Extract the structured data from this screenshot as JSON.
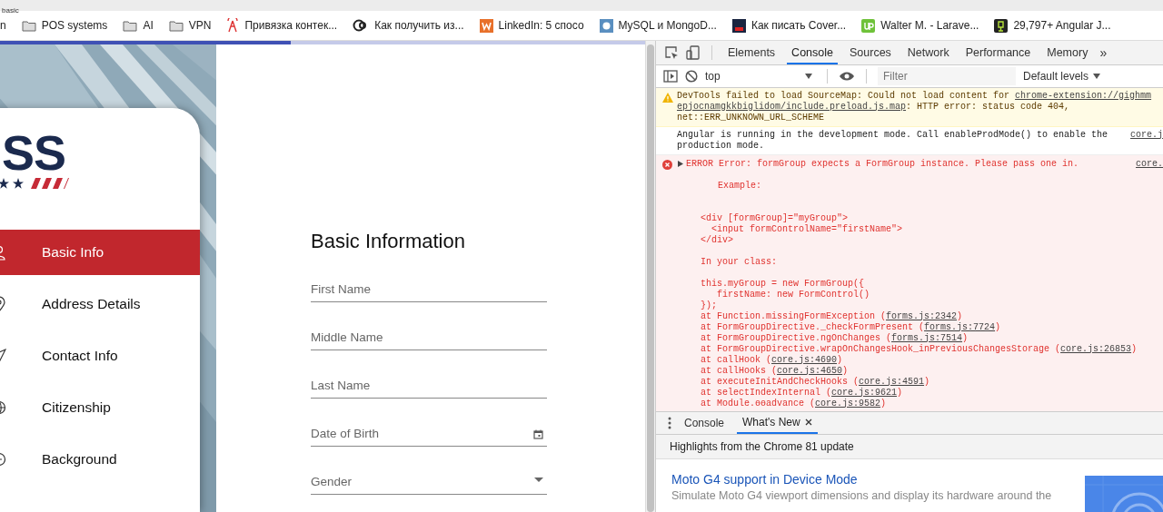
{
  "browser": {
    "tab_title": "basic",
    "bookmarks": [
      {
        "label": "n",
        "kind": "plain"
      },
      {
        "label": "POS systems",
        "kind": "folder"
      },
      {
        "label": "AI",
        "kind": "folder"
      },
      {
        "label": "VPN",
        "kind": "folder"
      },
      {
        "label": "Привязка контек...",
        "kind": "tower"
      },
      {
        "label": "Как получить из...",
        "kind": "ring"
      },
      {
        "label": "LinkedIn: 5 спосо",
        "kind": "w"
      },
      {
        "label": "MySQL и MongoD...",
        "kind": "puzzle"
      },
      {
        "label": "Как писать Cover...",
        "kind": "jff"
      },
      {
        "label": "Walter M. - Larave...",
        "kind": "up"
      },
      {
        "label": "29,797+ Angular J...",
        "kind": "chair"
      }
    ]
  },
  "page": {
    "progress": {
      "level": 0.45
    },
    "sidebar": {
      "logo": "SS",
      "items": [
        {
          "label": "Basic Info",
          "kind": "person",
          "selected": true
        },
        {
          "label": "Address Details",
          "kind": "pin",
          "selected": false
        },
        {
          "label": "Contact Info",
          "kind": "plane",
          "selected": false
        },
        {
          "label": "Citizenship",
          "kind": "globe",
          "selected": false
        },
        {
          "label": "Background",
          "kind": "minus",
          "selected": false
        }
      ]
    },
    "form": {
      "title": "Basic Information",
      "fields": [
        {
          "placeholder": "First Name",
          "kind": "text"
        },
        {
          "placeholder": "Middle Name",
          "kind": "text"
        },
        {
          "placeholder": "Last Name",
          "kind": "text"
        },
        {
          "placeholder": "Date of Birth",
          "kind": "date"
        },
        {
          "placeholder": "Gender",
          "kind": "select"
        }
      ]
    }
  },
  "devtools": {
    "tabs": [
      {
        "label": "Elements",
        "selected": false
      },
      {
        "label": "Console",
        "selected": true
      },
      {
        "label": "Sources",
        "selected": false
      },
      {
        "label": "Network",
        "selected": false
      },
      {
        "label": "Performance",
        "selected": false
      },
      {
        "label": "Memory",
        "selected": false
      }
    ],
    "more": "»",
    "context": "top",
    "filter": {
      "placeholder": "Filter"
    },
    "levels": "Default levels",
    "warning": {
      "lines": [
        [
          {
            "text": "DevTools failed to load SourceMap: Could not load content for ",
            "kind": "text"
          },
          {
            "text": "chrome-extension://gighmm",
            "kind": "link"
          }
        ],
        [
          {
            "text": "epjocnamgkkbiglidom/include.preload.js.map",
            "kind": "link"
          },
          {
            "text": ": HTTP error: status code 404,",
            "kind": "text"
          }
        ],
        [
          {
            "text": "net::ERR_UNKNOWN_URL_SCHEME",
            "kind": "text"
          }
        ]
      ]
    },
    "info": {
      "lines": [
        "Angular is running in the development mode. Call enableProdMode() to enable the",
        "production mode."
      ],
      "source": "core.j"
    },
    "error": {
      "header": "ERROR Error: formGroup expects a FormGroup instance. Please pass one in.",
      "source": "core.",
      "example_label": "Example:",
      "html_example": [
        "<div [formGroup]=\"myGroup\">",
        "  <input formControlName=\"firstName\">",
        "</div>"
      ],
      "class_label": "In your class:",
      "ts_example": [
        "this.myGroup = new FormGroup({",
        "   firstName: new FormControl()",
        "});"
      ],
      "stack": [
        {
          "call": "at Function.missingFormException (",
          "location": "forms.js:2342",
          "tail": ")"
        },
        {
          "call": "at FormGroupDirective._checkFormPresent (",
          "location": "forms.js:7724",
          "tail": ")"
        },
        {
          "call": "at FormGroupDirective.ngOnChanges (",
          "location": "forms.js:7514",
          "tail": ")"
        },
        {
          "call": "at FormGroupDirective.wrapOnChangesHook_inPreviousChangesStorage (",
          "location": "core.js:26853",
          "tail": ")"
        },
        {
          "call": "at callHook (",
          "location": "core.js:4690",
          "tail": ")"
        },
        {
          "call": "at callHooks (",
          "location": "core.js:4650",
          "tail": ")"
        },
        {
          "call": "at executeInitAndCheckHooks (",
          "location": "core.js:4591",
          "tail": ")"
        },
        {
          "call": "at selectIndexInternal (",
          "location": "core.js:9621",
          "tail": ")"
        },
        {
          "call": "at Module.ɵɵadvance (",
          "location": "core.js:9582",
          "tail": ")"
        }
      ]
    },
    "drawer_tabs": [
      {
        "label": "Console",
        "selected": false,
        "closable": false
      },
      {
        "label": "What's New",
        "selected": true,
        "closable": true
      }
    ],
    "whats_new": {
      "heading": "Highlights from the Chrome 81 update",
      "items": [
        {
          "title": "Moto G4 support in Device Mode",
          "description": "Simulate Moto G4 viewport dimensions and display its hardware around the"
        }
      ]
    }
  }
}
